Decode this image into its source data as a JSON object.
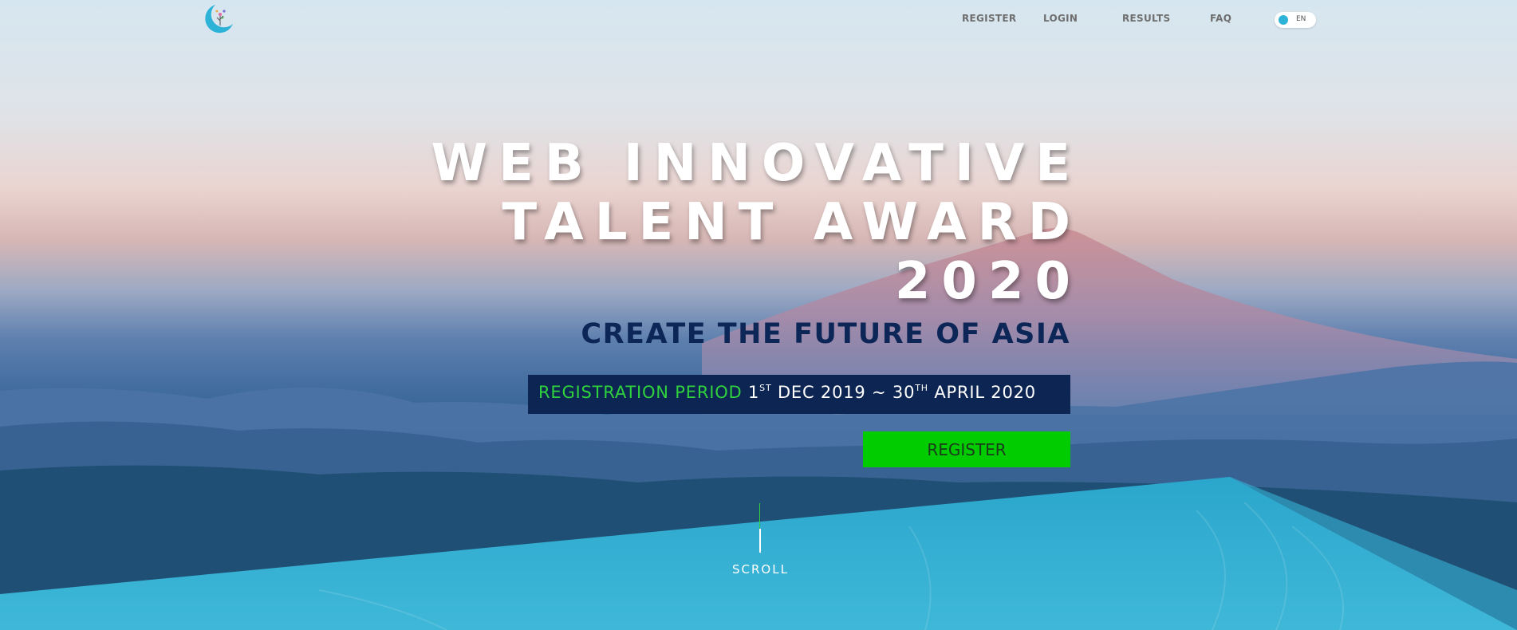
{
  "nav": {
    "register": "REGISTER",
    "login": "LOGIN",
    "results": "RESULTS",
    "faq": "FAQ",
    "language": "EN"
  },
  "hero": {
    "title_line1": "WEB INNOVATIVE",
    "title_line2": "TALENT AWARD",
    "title_line3": "2020",
    "subtitle": "CREATE THE FUTURE OF ASIA",
    "period_label": "REGISTRATION PERIOD",
    "period_day1": "1",
    "period_sup1": "ST",
    "period_mid": " DEC 2019 ~ 30",
    "period_sup2": "TH",
    "period_end": " APRIL 2020",
    "register_button": "REGISTER",
    "scroll": "SCROLL"
  },
  "colors": {
    "accent_green": "#00cc00",
    "period_bg": "#0d2552",
    "subtitle": "#0d2658",
    "cyan_panel": "#2fb0d4"
  },
  "icons": [
    "logo-icon",
    "language-toggle-dot-icon"
  ]
}
